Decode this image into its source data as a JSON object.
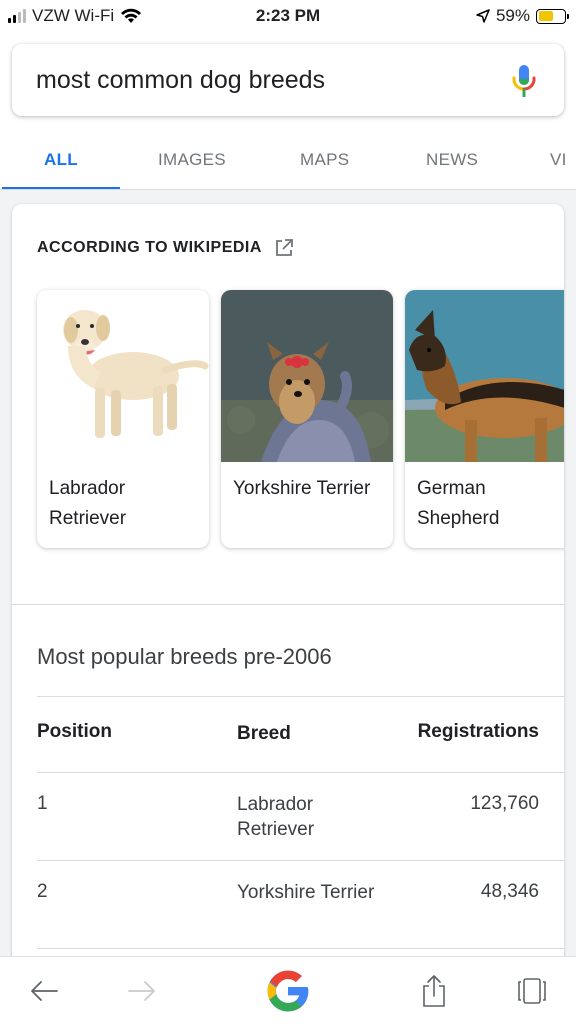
{
  "status_bar": {
    "carrier": "VZW Wi-Fi",
    "time": "2:23 PM",
    "battery": "59%",
    "battery_level": 0.59,
    "battery_color": "#f5c400"
  },
  "search": {
    "query": "most common dog breeds",
    "mic_icon": "microphone-icon"
  },
  "tabs": [
    "ALL",
    "IMAGES",
    "MAPS",
    "NEWS",
    "VI"
  ],
  "active_tab": "ALL",
  "accent_color": "#1a73e8",
  "knowledge": {
    "source_label": "ACCORDING TO WIKIPEDIA",
    "source_icon": "open-external-icon",
    "breeds": [
      {
        "label": "Labrador Retriever"
      },
      {
        "label": "Yorkshire Terrier"
      },
      {
        "label": "German Shepherd"
      }
    ]
  },
  "table": {
    "title": "Most popular breeds pre-2006",
    "headers": [
      "Position",
      "Breed",
      "Registrations"
    ],
    "rows": [
      [
        "1",
        "Labrador Retriever",
        "123,760"
      ],
      [
        "2",
        "Yorkshire Terrier",
        "48,346"
      ]
    ]
  },
  "bottom_bar": {
    "icons": [
      "back-arrow-icon",
      "forward-arrow-icon",
      "google-logo",
      "share-icon",
      "tabs-icon"
    ]
  }
}
